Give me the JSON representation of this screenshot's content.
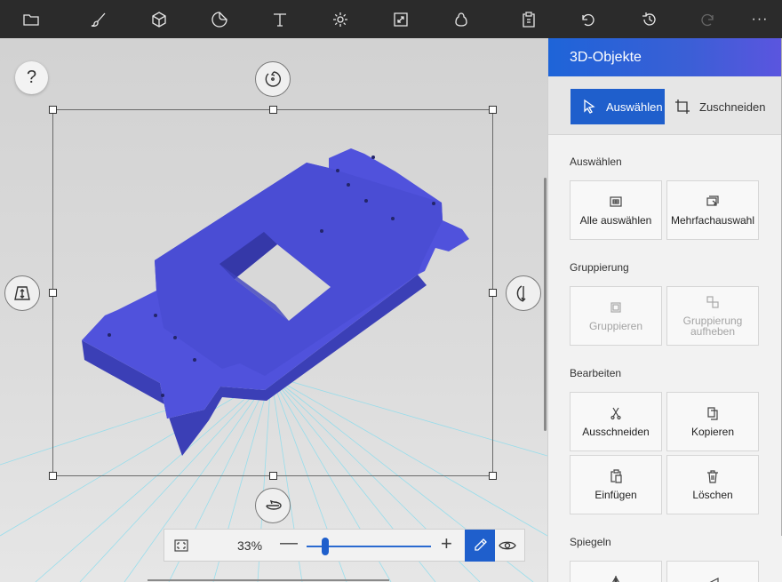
{
  "toolbar": {
    "icons": [
      "folder-icon",
      "brush-icon",
      "cube-icon",
      "sticker-icon",
      "text-icon",
      "effects-icon",
      "canvas-icon",
      "3d-library-icon",
      "paste-icon",
      "undo-icon",
      "history-icon",
      "redo-icon"
    ],
    "more_label": "···"
  },
  "canvas": {
    "help_label": "?",
    "zoom_percent": "33%",
    "zoom_minus": "—",
    "zoom_plus": "+",
    "zoom_level": 0.15
  },
  "panel": {
    "title": "3D-Objekte",
    "modes": {
      "select": "Auswählen",
      "crop": "Zuschneiden"
    },
    "sections": {
      "select": {
        "label": "Auswählen",
        "select_all": "Alle auswählen",
        "multi_select": "Mehrfachauswahl"
      },
      "group": {
        "label": "Gruppierung",
        "group": "Gruppieren",
        "ungroup": "Gruppierung aufheben"
      },
      "edit": {
        "label": "Bearbeiten",
        "cut": "Ausschneiden",
        "copy": "Kopieren",
        "paste": "Einfügen",
        "delete": "Löschen"
      },
      "mirror": {
        "label": "Spiegeln"
      }
    }
  },
  "colors": {
    "accent": "#1f5fcc",
    "object": "#4c51d6",
    "grid": "#5fd0e8"
  }
}
